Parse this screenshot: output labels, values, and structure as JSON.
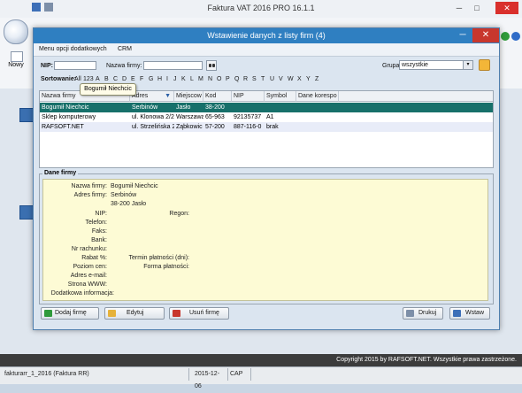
{
  "app": {
    "title": "Faktura VAT 2016 PRO 16.1.1",
    "minimize": "─",
    "maximize": "□",
    "close": "✕",
    "new_label": "Nowy",
    "copyright": "Copyright 2015 by RAFSOFT.NET. Wszystkie prawa zastrzeżone.",
    "status": {
      "file": "fakturarr_1_2016 (Faktura RR)",
      "date": "2015-12-06",
      "caps": "CAP"
    }
  },
  "dialog": {
    "title": "Wstawienie danych z listy firm (4)",
    "minimize": "─",
    "close": "✕",
    "menu": [
      "Menu opcji dodatkowych",
      "CRM"
    ],
    "filters": {
      "nip_label": "NIP:",
      "nip_value": "",
      "name_label": "Nazwa firmy:",
      "name_value": "",
      "group_label": "Grupa:",
      "group_value": "wszystkie",
      "dropdown_arrow": "▾"
    },
    "sort": {
      "label": "Sortowanie:",
      "letters": [
        "All",
        "123",
        "A",
        "B",
        "C",
        "D",
        "E",
        "F",
        "G",
        "H",
        "I",
        "J",
        "K",
        "L",
        "M",
        "N",
        "O",
        "P",
        "Q",
        "R",
        "S",
        "T",
        "U",
        "V",
        "W",
        "X",
        "Y",
        "Z"
      ]
    },
    "grid": {
      "columns": [
        "Nazwa firmy",
        "Adres",
        "Miejscow",
        "Kod",
        "NIP",
        "Symbol",
        "Dane korespo"
      ],
      "sort_arrow": "▼",
      "rows": [
        [
          "Bogumił Niechcic",
          "Serbinów",
          "Jasło",
          "38-200",
          "",
          "",
          ""
        ],
        [
          "Sklep komputerowy",
          "ul. Klonowa 2/2",
          "Warszawa",
          "65-963",
          "92135737",
          "A1",
          ""
        ],
        [
          "RAFSOFT.NET",
          "ul. Strzelińska 2",
          "Ząbkowic",
          "57-200",
          "887-116-0",
          "brak",
          ""
        ]
      ],
      "selected_row": 0,
      "tooltip": "Bogumił Niechcic"
    },
    "details": {
      "title": "Dane firmy",
      "fields": [
        {
          "label": "Nazwa firmy:",
          "value": "Bogumił Niechcic"
        },
        {
          "label": "Adres firmy:",
          "value": "Serbinów"
        },
        {
          "label": "",
          "value": "38-200 Jasło"
        },
        {
          "label": "NIP:",
          "value": ""
        },
        {
          "label": "Telefon:",
          "value": ""
        },
        {
          "label": "Faks:",
          "value": ""
        },
        {
          "label": "Bank:",
          "value": ""
        },
        {
          "label": "Nr rachunku:",
          "value": ""
        },
        {
          "label": "Rabat %:",
          "value": ""
        },
        {
          "label": "Poziom cen:",
          "value": ""
        },
        {
          "label": "Adres e-mail:",
          "value": ""
        },
        {
          "label": "Strona WWW:",
          "value": ""
        },
        {
          "label": "Dodatkowa informacja:",
          "value": ""
        }
      ],
      "right_fields": [
        {
          "label": "Regon:",
          "value": ""
        },
        {
          "label": "Termin płatności (dni):",
          "value": ""
        },
        {
          "label": "Forma płatności:",
          "value": ""
        }
      ]
    },
    "buttons": {
      "add": "Dodaj firmę",
      "edit": "Edytuj",
      "delete": "Usuń firmę",
      "print": "Drukuj",
      "insert": "Wstaw"
    },
    "colors": {
      "title_bar": "#2f7fc1",
      "selected_row": "#17706a",
      "row_stripe": "#e8ecf8"
    }
  }
}
